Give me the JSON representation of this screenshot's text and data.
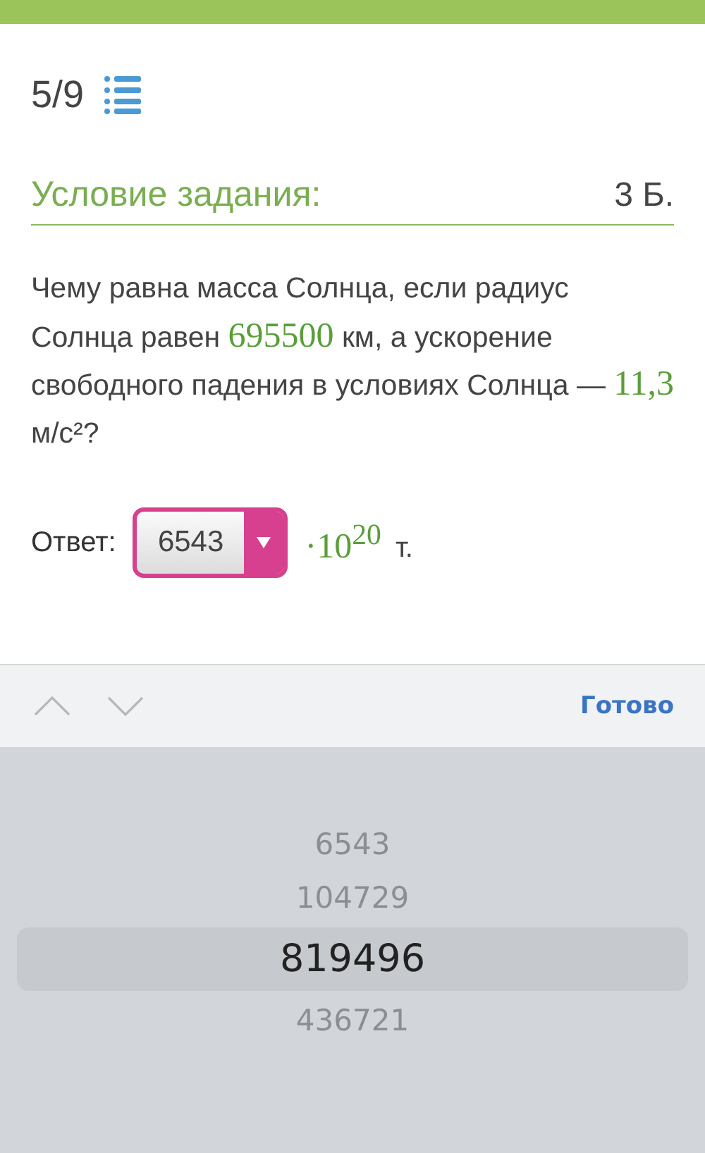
{
  "progress": {
    "counter": "5/9"
  },
  "task": {
    "heading": "Условие задания:",
    "points": "3 Б.",
    "question": [
      {
        "kind": "text",
        "text": "Чему равна масса Солнца, если радиус Солнца равен "
      },
      {
        "kind": "value",
        "text": "695500"
      },
      {
        "kind": "text",
        "text": " км, а ускорение свободного падения в условиях Солнца — "
      },
      {
        "kind": "value",
        "text": "11,3"
      },
      {
        "kind": "text",
        "text": " м/с²?"
      }
    ]
  },
  "answer": {
    "label": "Ответ:",
    "value": "6543",
    "multiplier": "·10$^{20}$",
    "unit": "т."
  },
  "toolbar": {
    "done": "Готово"
  },
  "picker": [
    {
      "text": "6543",
      "selected": false
    },
    {
      "text": "104729",
      "selected": false
    },
    {
      "text": "819496",
      "selected": true
    },
    {
      "text": "436721",
      "selected": false
    }
  ]
}
